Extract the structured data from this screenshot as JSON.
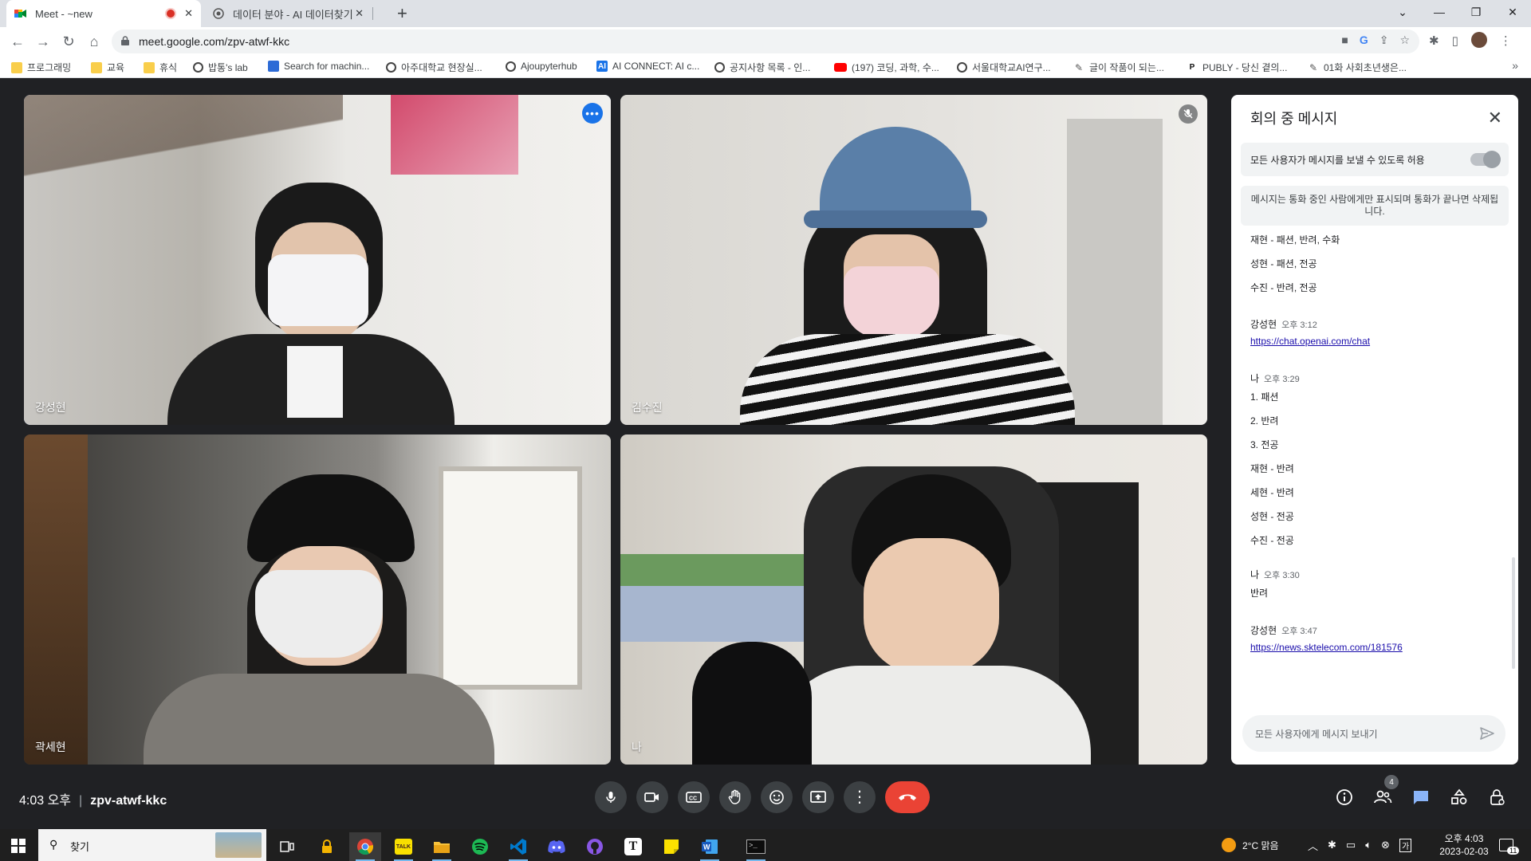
{
  "browser": {
    "tabs": [
      {
        "title": "Meet - ~new",
        "recording": true
      },
      {
        "title": "데이터 분야 - AI 데이터찾기 - AI"
      }
    ],
    "url_host": "meet.google.com",
    "url_path": "/zpv-atwf-kkc",
    "bookmarks": [
      {
        "label": "프로그래밍",
        "icon": "folder"
      },
      {
        "label": "교육",
        "icon": "folder"
      },
      {
        "label": "휴식",
        "icon": "folder"
      },
      {
        "label": "밥통's lab",
        "icon": "globe"
      },
      {
        "label": "Search for machin...",
        "icon": "page"
      },
      {
        "label": "아주대학교 현장실...",
        "icon": "globe"
      },
      {
        "label": "Ajoupyterhub",
        "icon": "globe"
      },
      {
        "label": "AI CONNECT: AI c...",
        "icon": "ai-connect"
      },
      {
        "label": "공지사항 목록 - 인...",
        "icon": "globe"
      },
      {
        "label": "(197) 코딩, 과학, 수...",
        "icon": "youtube"
      },
      {
        "label": "서울대학교AI연구...",
        "icon": "globe"
      },
      {
        "label": "글이 작품이 되는...",
        "icon": "pen"
      },
      {
        "label": "PUBLY - 당신 곁의...",
        "icon": "publy"
      },
      {
        "label": "01화 사회초년생은...",
        "icon": "pen"
      }
    ],
    "bookmarks_more": "»"
  },
  "participants": [
    {
      "name": "강성현",
      "speaking": true
    },
    {
      "name": "김수진",
      "muted": true
    },
    {
      "name": "곽세현"
    },
    {
      "name": "나"
    }
  ],
  "chat": {
    "title": "회의 중 메시지",
    "allow_label": "모든 사용자가 메시지를 보낼 수 있도록 허용",
    "notice": "메시지는 통화 중인 사람에게만 표시되며 통화가 끝나면 삭제됩니다.",
    "top_lines": [
      "재현 - 패션, 반려, 수화",
      "성현 - 패션, 전공",
      "수진 - 반려, 전공"
    ],
    "messages": [
      {
        "sender": "강성현",
        "time": "오후 3:12",
        "lines": [],
        "link": "https://chat.openai.com/chat"
      },
      {
        "sender": "나",
        "time": "오후 3:29",
        "lines": [
          "1. 패션",
          "2. 반려",
          "3. 전공",
          "재현 - 반려",
          "세현 - 반려",
          "성현 - 전공",
          "수진 - 전공"
        ],
        "link": ""
      },
      {
        "sender": "나",
        "time": "오후 3:30",
        "lines": [
          "반려"
        ],
        "link": ""
      },
      {
        "sender": "강성현",
        "time": "오후 3:47",
        "lines": [],
        "link": "https://news.sktelecom.com/181576"
      }
    ],
    "input_placeholder": "모든 사용자에게 메시지 보내기"
  },
  "meeting": {
    "time": "4:03 오후",
    "code": "zpv-atwf-kkc",
    "people_count": "4",
    "colors": {
      "end_call": "#ea4335",
      "speaking_outline": "#8ab4f8",
      "chat_active": "#8ab4f8"
    }
  },
  "taskbar": {
    "search_label": "찾기",
    "weather": "2°C  맑음",
    "time": "오후 4:03",
    "date": "2023-02-03",
    "notifications": "11"
  }
}
